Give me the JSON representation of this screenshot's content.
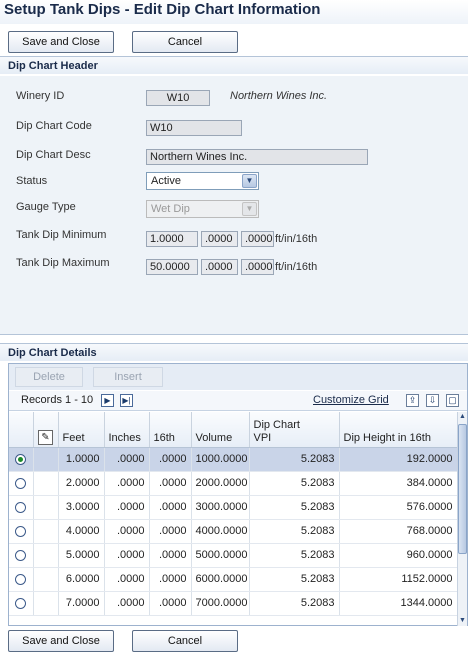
{
  "title": "Setup Tank Dips - Edit Dip Chart Information",
  "buttons": {
    "save_close": "Save and Close",
    "cancel": "Cancel"
  },
  "header_section": {
    "title": "Dip Chart Header",
    "winery_id": {
      "label": "Winery ID",
      "value": "W10",
      "description": "Northern Wines Inc."
    },
    "dip_chart_code": {
      "label": "Dip Chart Code",
      "value": "W10"
    },
    "dip_chart_desc": {
      "label": "Dip Chart Desc",
      "value": "Northern Wines Inc."
    },
    "status": {
      "label": "Status",
      "value": "Active"
    },
    "gauge_type": {
      "label": "Gauge Type",
      "value": "Wet Dip"
    },
    "tank_dip_min": {
      "label": "Tank Dip Minimum",
      "feet": "1.0000",
      "inches": ".0000",
      "sixteenth": ".0000",
      "unit": "ft/in/16th"
    },
    "tank_dip_max": {
      "label": "Tank Dip Maximum",
      "feet": "50.0000",
      "inches": ".0000",
      "sixteenth": ".0000",
      "unit": "ft/in/16th"
    }
  },
  "details_section": {
    "title": "Dip Chart Details",
    "toolbar": {
      "delete": "Delete",
      "insert": "Insert"
    },
    "records_label": "Records 1 - 10",
    "customize_grid": "Customize Grid",
    "columns": {
      "feet": "Feet",
      "inches": "Inches",
      "sixteenth": "16th",
      "volume": "Volume",
      "vpi_line1": "Dip Chart",
      "vpi_line2": "VPI",
      "height": "Dip Height in 16th"
    },
    "rows": [
      {
        "feet": "1.0000",
        "inches": ".0000",
        "sixteenth": ".0000",
        "volume": "1000.0000",
        "vpi": "5.2083",
        "height": "192.0000"
      },
      {
        "feet": "2.0000",
        "inches": ".0000",
        "sixteenth": ".0000",
        "volume": "2000.0000",
        "vpi": "5.2083",
        "height": "384.0000"
      },
      {
        "feet": "3.0000",
        "inches": ".0000",
        "sixteenth": ".0000",
        "volume": "3000.0000",
        "vpi": "5.2083",
        "height": "576.0000"
      },
      {
        "feet": "4.0000",
        "inches": ".0000",
        "sixteenth": ".0000",
        "volume": "4000.0000",
        "vpi": "5.2083",
        "height": "768.0000"
      },
      {
        "feet": "5.0000",
        "inches": ".0000",
        "sixteenth": ".0000",
        "volume": "5000.0000",
        "vpi": "5.2083",
        "height": "960.0000"
      },
      {
        "feet": "6.0000",
        "inches": ".0000",
        "sixteenth": ".0000",
        "volume": "6000.0000",
        "vpi": "5.2083",
        "height": "1152.0000"
      },
      {
        "feet": "7.0000",
        "inches": ".0000",
        "sixteenth": ".0000",
        "volume": "7000.0000",
        "vpi": "5.2083",
        "height": "1344.0000"
      }
    ]
  }
}
